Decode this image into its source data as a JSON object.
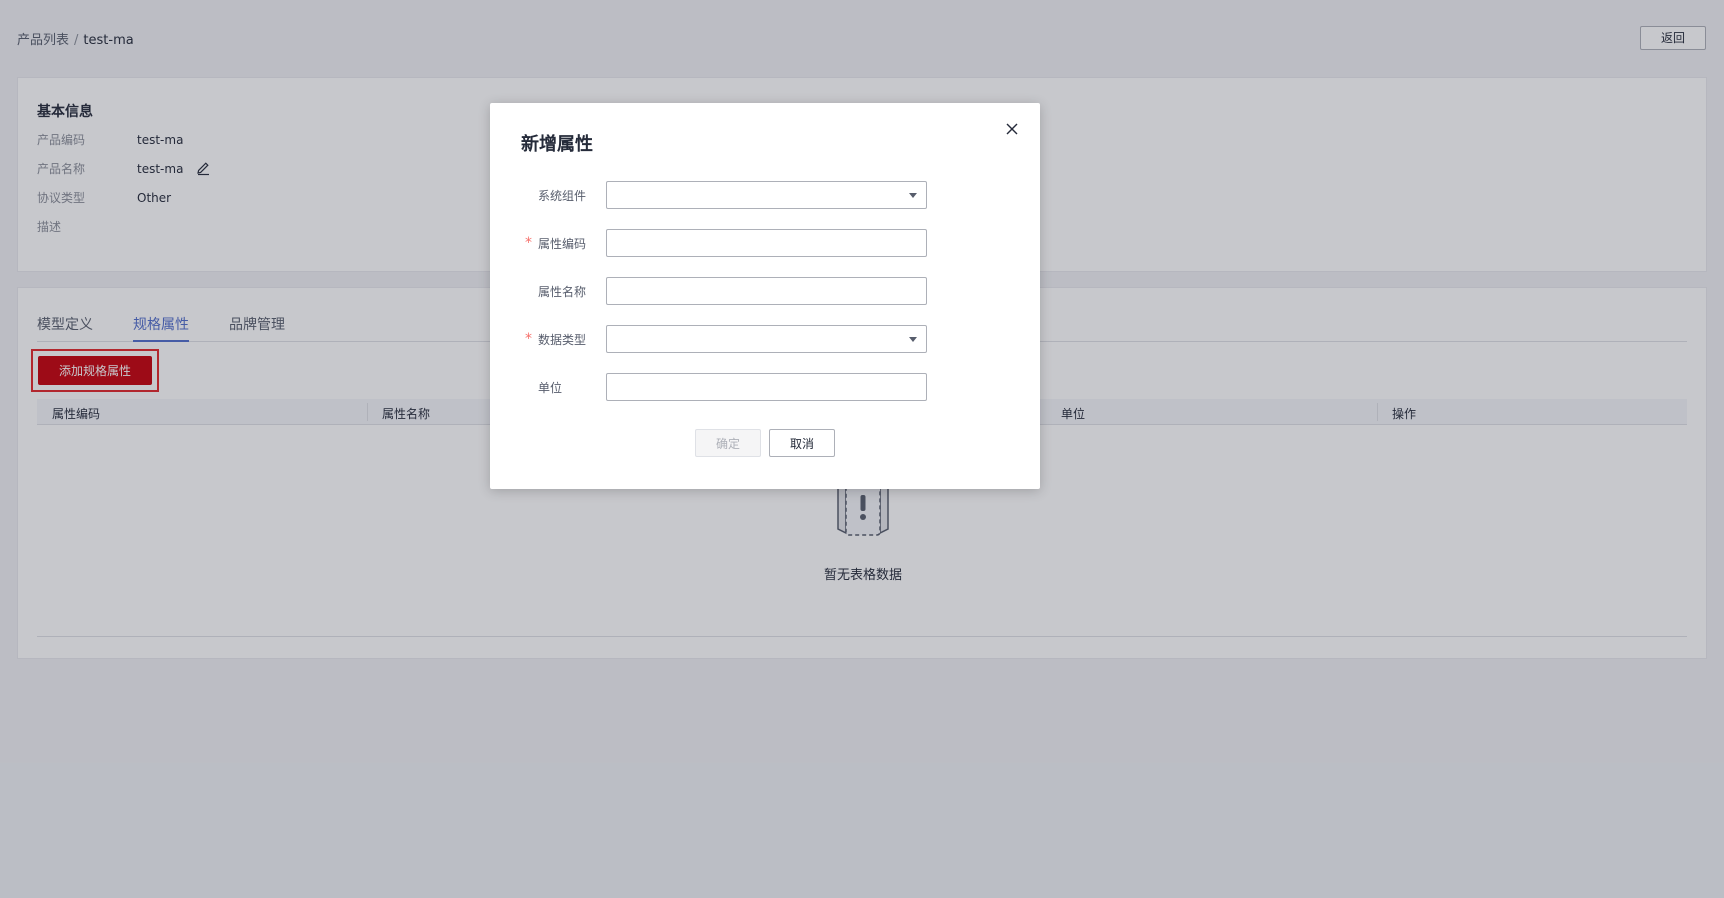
{
  "breadcrumb": {
    "parent": "产品列表",
    "separator": "/",
    "current": "test-ma"
  },
  "header": {
    "back_label": "返回"
  },
  "basic_info": {
    "title": "基本信息",
    "rows": [
      {
        "label": "产品编码",
        "value": "test-ma"
      },
      {
        "label": "产品名称",
        "value": "test-ma"
      },
      {
        "label": "协议类型",
        "value": "Other"
      },
      {
        "label": "描述",
        "value": ""
      }
    ]
  },
  "tabs": [
    {
      "label": "模型定义",
      "active": false
    },
    {
      "label": "规格属性",
      "active": true
    },
    {
      "label": "品牌管理",
      "active": false
    }
  ],
  "add_button_label": "添加规格属性",
  "table": {
    "columns": [
      "属性编码",
      "属性名称",
      "单位",
      "操作"
    ],
    "empty_text": "暂无表格数据"
  },
  "dialog": {
    "title": "新增属性",
    "fields": [
      {
        "label": "系统组件",
        "required": false,
        "type": "select",
        "value": ""
      },
      {
        "label": "属性编码",
        "required": true,
        "type": "text",
        "value": ""
      },
      {
        "label": "属性名称",
        "required": false,
        "type": "text",
        "value": ""
      },
      {
        "label": "数据类型",
        "required": true,
        "type": "select",
        "value": ""
      },
      {
        "label": "单位",
        "required": false,
        "type": "text",
        "value": ""
      }
    ],
    "required_mark": "*",
    "confirm_label": "确定",
    "cancel_label": "取消"
  },
  "colors": {
    "primary_red": "#c7000b",
    "highlight_border": "#e3262b",
    "tab_active": "#526ecc",
    "required_mark": "#f66f6a"
  }
}
